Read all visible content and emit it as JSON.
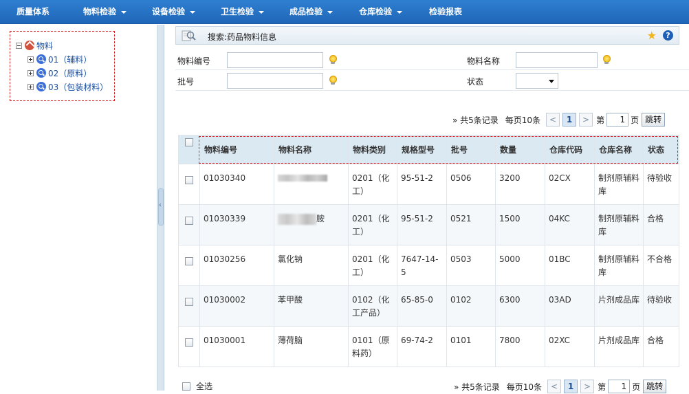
{
  "nav": {
    "items": [
      {
        "label": "质量体系",
        "dropdown": false
      },
      {
        "label": "物料检验",
        "dropdown": true
      },
      {
        "label": "设备检验",
        "dropdown": true
      },
      {
        "label": "卫生检验",
        "dropdown": true
      },
      {
        "label": "成品检验",
        "dropdown": true
      },
      {
        "label": "仓库检验",
        "dropdown": true
      },
      {
        "label": "检验报表",
        "dropdown": false
      }
    ]
  },
  "tree": {
    "root": "物料",
    "children": [
      "01（辅料）",
      "02（原料）",
      "03（包装材料）"
    ]
  },
  "search": {
    "title": "搜索:药品物料信息",
    "fields": {
      "code_label": "物料编号",
      "name_label": "物料名称",
      "batch_label": "批号",
      "status_label": "状态",
      "code_value": "",
      "name_value": "",
      "batch_value": "",
      "status_value": ""
    }
  },
  "pager": {
    "total": "» 共5条记录",
    "per_page": "每页10条",
    "prev": "<",
    "current": "1",
    "next": ">",
    "page_prefix": "第",
    "page_input": "1",
    "page_suffix": "页",
    "go": "跳转"
  },
  "table": {
    "columns": [
      "物料编号",
      "物料名称",
      "物料类别",
      "规格型号",
      "批号",
      "数量",
      "仓库代码",
      "仓库名称",
      "状态"
    ],
    "rows": [
      {
        "code": "01030340",
        "name": "",
        "category": "0201（化工）",
        "spec": "95-51-2",
        "batch": "0506",
        "qty": "3200",
        "wh_code": "02CX",
        "wh_name": "制剂原辅料库",
        "status": "待验收"
      },
      {
        "code": "01030339",
        "name": "胺",
        "category": "0201（化工）",
        "spec": "95-51-2",
        "batch": "0521",
        "qty": "1500",
        "wh_code": "04KC",
        "wh_name": "制剂原辅料库",
        "status": "合格"
      },
      {
        "code": "01030256",
        "name": "氯化钠",
        "category": "0201（化工）",
        "spec": "7647-14-5",
        "batch": "0503",
        "qty": "5000",
        "wh_code": "01BC",
        "wh_name": "制剂原辅料库",
        "status": "不合格"
      },
      {
        "code": "01030002",
        "name": "苯甲酸",
        "category": "0102（化工产品）",
        "spec": "65-85-0",
        "batch": "0102",
        "qty": "6300",
        "wh_code": "03AD",
        "wh_name": "片剂成品库",
        "status": "待验收"
      },
      {
        "code": "01030001",
        "name": "薄荷脑",
        "category": "0101（原料药）",
        "spec": "69-74-2",
        "batch": "0101",
        "qty": "7800",
        "wh_code": "02XC",
        "wh_name": "片剂成品库",
        "status": "合格"
      }
    ]
  },
  "footer": {
    "select_all": "全选"
  },
  "colors": {
    "nav_bg": "#1f66b8",
    "header_bg": "#dbe9f2",
    "highlight": "#d4262b",
    "link": "#1a4b8c"
  }
}
